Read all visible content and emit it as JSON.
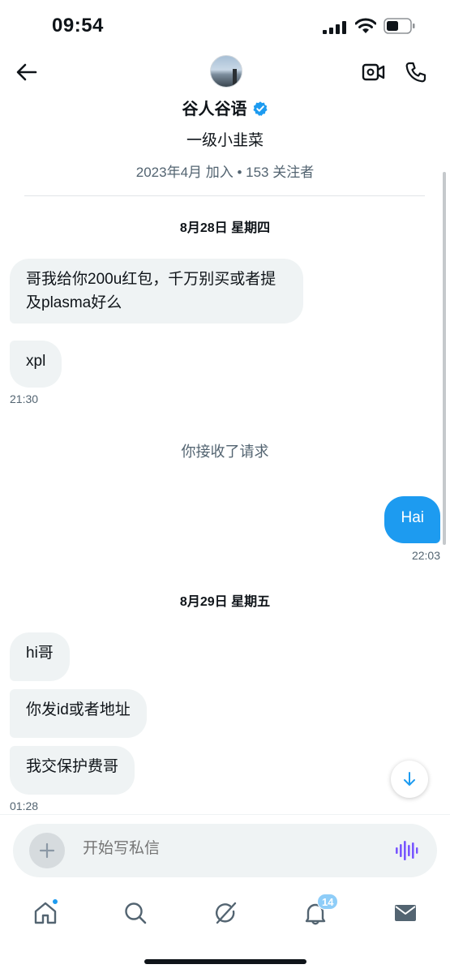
{
  "status_bar": {
    "time": "09:54",
    "battery_level": 0.45
  },
  "header": {
    "profile_name": "谷人谷语",
    "verified": true,
    "bio": "一级小韭菜",
    "meta": "2023年4月 加入 • 153 关注者"
  },
  "messages": {
    "date_1": "8月28日 星期四",
    "in_1": "哥我给你200u红包，千万别买或者提及plasma好么",
    "in_2": "xpl",
    "ts_1": "21:30",
    "system": "你接收了请求",
    "out_1": "Hai",
    "ts_2": "22:03",
    "date_2": "8月29日 星期五",
    "in_3": "hi哥",
    "in_4": "你发id或者地址",
    "in_5": "我交保护费哥",
    "ts_3": "01:28"
  },
  "composer": {
    "placeholder": "开始写私信"
  },
  "nav": {
    "items": [
      {
        "name": "home",
        "icon": "home-icon",
        "dot": true
      },
      {
        "name": "explore",
        "icon": "search-icon"
      },
      {
        "name": "grok",
        "icon": "grok-icon"
      },
      {
        "name": "notifications",
        "icon": "bell-icon",
        "badge": "14"
      },
      {
        "name": "messages",
        "icon": "mail-icon"
      }
    ],
    "badge": "14"
  },
  "colors": {
    "accent": "#1d9bf0",
    "incoming_bubble": "#eff3f4",
    "muted_text": "#536471",
    "voice_icon": "#7856ff"
  }
}
